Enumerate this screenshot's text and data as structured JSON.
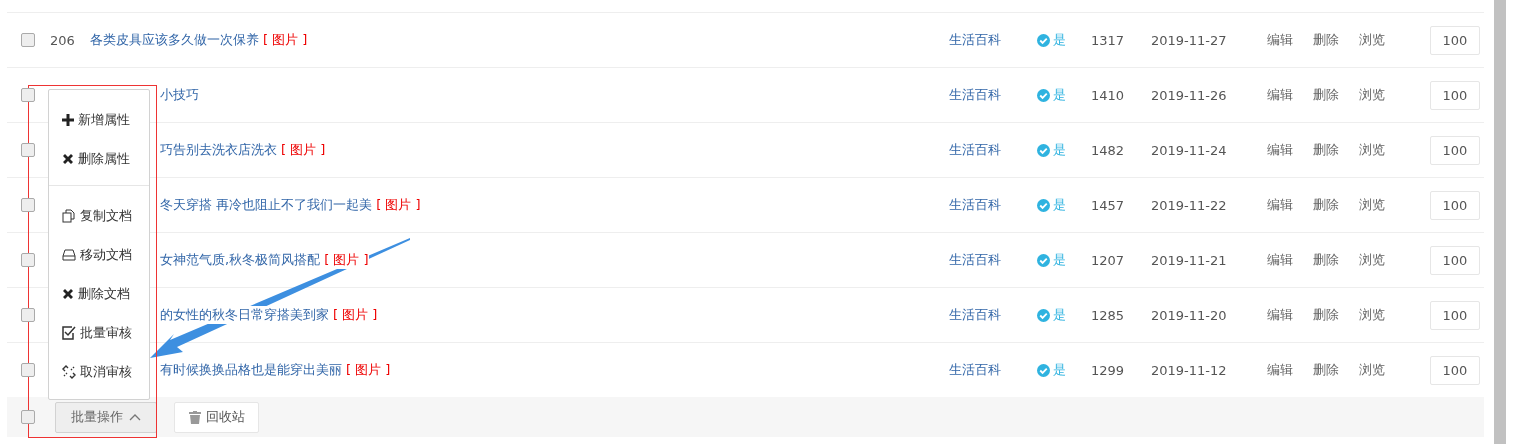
{
  "rows": [
    {
      "checked": false,
      "id": "206",
      "title": "各类皮具应该多久做一次保养",
      "tag": "[ 图片 ]",
      "category": "生活百科",
      "status": "是",
      "views": "1317",
      "date": "2019-11-27",
      "actions": [
        "编辑",
        "删除",
        "浏览"
      ],
      "sort": "100"
    },
    {
      "checked": false,
      "title": "小技巧",
      "category": "生活百科",
      "status": "是",
      "views": "1410",
      "date": "2019-11-26",
      "actions": [
        "编辑",
        "删除",
        "浏览"
      ],
      "sort": "100"
    },
    {
      "checked": false,
      "title": "巧告别去洗衣店洗衣",
      "tag": "[ 图片 ]",
      "category": "生活百科",
      "status": "是",
      "views": "1482",
      "date": "2019-11-24",
      "actions": [
        "编辑",
        "删除",
        "浏览"
      ],
      "sort": "100"
    },
    {
      "checked": false,
      "title": "冬天穿搭 再冷也阻止不了我们一起美",
      "tag": "[ 图片 ]",
      "category": "生活百科",
      "status": "是",
      "views": "1457",
      "date": "2019-11-22",
      "actions": [
        "编辑",
        "删除",
        "浏览"
      ],
      "sort": "100"
    },
    {
      "checked": false,
      "title": "女神范气质,秋冬极简风搭配",
      "tag": "[ 图片 ]",
      "category": "生活百科",
      "status": "是",
      "views": "1207",
      "date": "2019-11-21",
      "actions": [
        "编辑",
        "删除",
        "浏览"
      ],
      "sort": "100"
    },
    {
      "checked": false,
      "title": "的女性的秋冬日常穿搭美到家",
      "tag": "[ 图片 ]",
      "category": "生活百科",
      "status": "是",
      "views": "1285",
      "date": "2019-11-20",
      "actions": [
        "编辑",
        "删除",
        "浏览"
      ],
      "sort": "100"
    },
    {
      "checked": false,
      "title": "有时候换换品格也是能穿出美丽",
      "tag": "[ 图片 ]",
      "category": "生活百科",
      "status": "是",
      "views": "1299",
      "date": "2019-11-12",
      "actions": [
        "编辑",
        "删除",
        "浏览"
      ],
      "sort": "100"
    }
  ],
  "batch_menu": {
    "open": true,
    "groups": [
      [
        {
          "kind": "plus",
          "label": "新增属性"
        },
        {
          "kind": "cross",
          "label": "删除属性"
        }
      ],
      [
        {
          "kind": "copy",
          "label": "复制文档"
        },
        {
          "kind": "move",
          "label": "移动文档"
        },
        {
          "kind": "cross",
          "label": "删除文档"
        },
        {
          "kind": "check",
          "label": "批量审核"
        },
        {
          "kind": "unlink",
          "label": "取消审核"
        }
      ]
    ]
  },
  "footer": {
    "checked": false,
    "batch_button": "批量操作",
    "recycle_button": "回收站"
  }
}
